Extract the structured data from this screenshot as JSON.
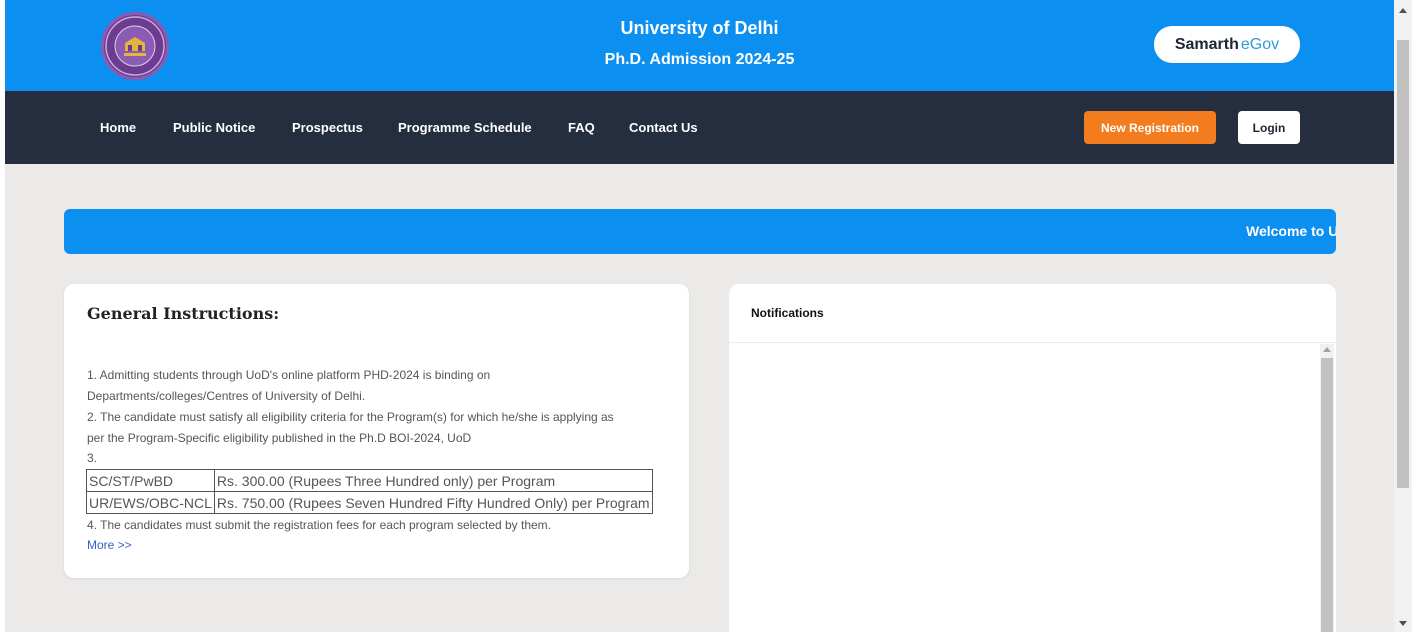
{
  "header": {
    "title": "University of Delhi",
    "subtitle": "Ph.D. Admission 2024-25",
    "brand_part1": "Samarth",
    "brand_part2": "eGov"
  },
  "nav": {
    "items": [
      "Home",
      "Public Notice",
      "Prospectus",
      "Programme Schedule",
      "FAQ",
      "Contact Us"
    ],
    "register_label": "New Registration",
    "login_label": "Login"
  },
  "banner": {
    "text": "Welcome to U"
  },
  "instructions": {
    "title": "General Instructions:",
    "lines": [
      "1. Admitting students through UoD's online platform PHD-2024 is binding on",
      "Departments/colleges/Centres of University of Delhi.",
      "2. The candidate must satisfy all eligibility criteria for the Program(s) for which he/she is applying as",
      "per the Program-Specific eligibility published in the Ph.D BOI-2024, UoD",
      "3."
    ],
    "fees": [
      {
        "category": "SC/ST/PwBD",
        "fee": "Rs. 300.00 (Rupees Three Hundred only) per Program"
      },
      {
        "category": "UR/EWS/OBC-NCL",
        "fee": "Rs. 750.00 (Rupees Seven Hundred Fifty Hundred Only) per Program"
      }
    ],
    "line4": "4. The candidates must submit the registration fees for each program selected by them.",
    "more_label": "More >>"
  },
  "notifications": {
    "title": "Notifications"
  },
  "colors": {
    "header_bg": "#0b8ff0",
    "navbar_bg": "#252e3e",
    "register_bg": "#f27c1e",
    "page_bg": "#eceae8"
  },
  "icons": {
    "logo": "university-seal-icon"
  }
}
